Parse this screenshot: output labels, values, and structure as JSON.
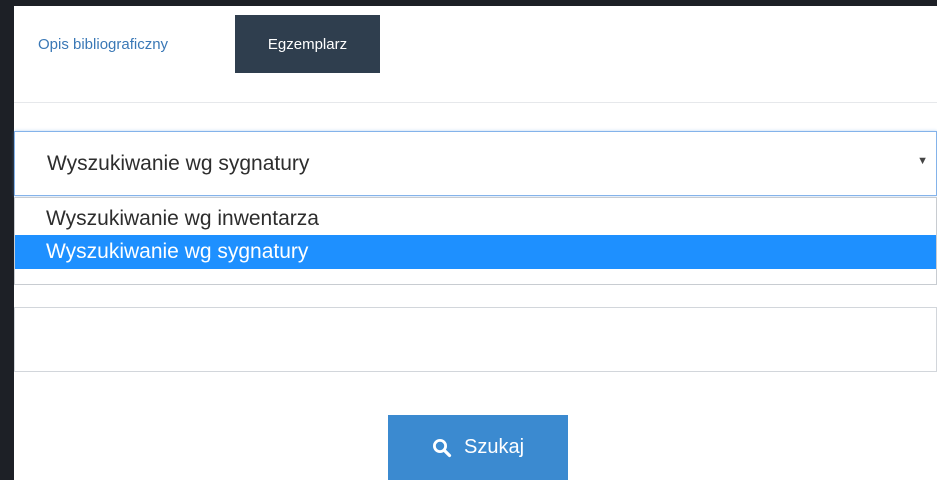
{
  "tabs": {
    "bibliographic_label": "Opis bibliograficzny",
    "copy_label": "Egzemplarz"
  },
  "search_type": {
    "selected": "Wyszukiwanie wg sygnatury",
    "options": [
      "Wyszukiwanie wg inwentarza",
      "Wyszukiwanie wg sygnatury"
    ],
    "arrow_icon": "caret-down-icon"
  },
  "query": {
    "value": ""
  },
  "search_button": {
    "label": "Szukaj",
    "icon": "search-icon"
  },
  "colors": {
    "active_tab_bg": "#2f3e4e",
    "link": "#3a78b6",
    "highlight": "#1e90ff",
    "button": "#3b8ad0"
  }
}
